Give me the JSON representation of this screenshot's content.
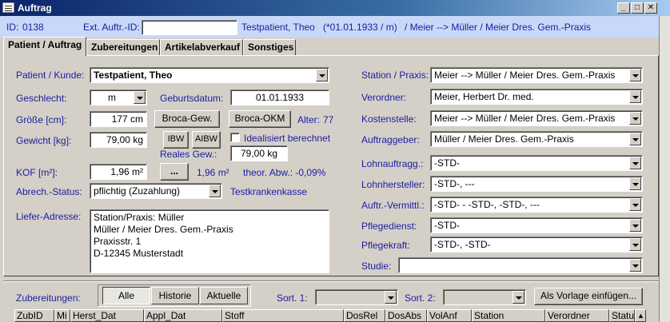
{
  "window": {
    "title": "Auftrag",
    "btn_min": "_",
    "btn_max": "□",
    "btn_close": "✕"
  },
  "header": {
    "id_label": "ID:",
    "id_value": "0138",
    "ext_label": "Ext. Auftr.-ID:",
    "ext_value": "",
    "patient_summary": "Testpatient, Theo",
    "birth_summary": "(*01.01.1933 / m)",
    "praxis_summary": "/ Meier --> Müller / Meier Dres. Gem.-Praxis"
  },
  "tabs": [
    {
      "label": "Patient / Auftrag",
      "active": true
    },
    {
      "label": "Zubereitungen",
      "active": false
    },
    {
      "label": "Artikelabverkauf",
      "active": false
    },
    {
      "label": "Sonstiges",
      "active": false
    }
  ],
  "form": {
    "patient_label": "Patient / Kunde:",
    "patient_value": "Testpatient, Theo",
    "sex_label": "Geschlecht:",
    "sex_value": "m",
    "birth_label": "Geburtsdatum:",
    "birth_value": "01.01.1933",
    "size_label": "Größe [cm]:",
    "size_value": "177 cm",
    "broca_gew": "Broca-Gew.",
    "broca_okm": "Broca-OKM",
    "age_label": "Alter:",
    "age_value": "77",
    "weight_label": "Gewicht [kg]:",
    "weight_value": "79,00 kg",
    "ibw": "IBW",
    "aibw": "AIBW",
    "ideal_label": "Idealisiert berechnet",
    "real_weight_label": "Reales Gew.:",
    "real_weight_value": "79,00 kg",
    "kof_label": "KOF [m²]:",
    "kof_value": "1,96 m²",
    "kof_btn": "...",
    "kof_theor": "1,96 m²",
    "kof_abw": "theor. Abw.: -0,09%",
    "billing_label": "Abrech.-Status:",
    "billing_value": "pflichtig (Zuzahlung)",
    "insurer": "Testkrankenkasse",
    "address_label": "Liefer-Adresse:",
    "address_lines": {
      "l1": "Station/Praxis: Müller",
      "l2": "Müller / Meier Dres. Gem.-Praxis",
      "l3": "Praxisstr. 1",
      "l4": "D-12345 Musterstadt"
    }
  },
  "right_form": {
    "station_label": "Station / Praxis:",
    "station_value": "Meier --> Müller / Meier Dres. Gem.-Praxis",
    "verordner_label": "Verordner:",
    "verordner_value": "Meier, Herbert Dr. med.",
    "kosten_label": "Kostenstelle:",
    "kosten_value": "Meier --> Müller / Meier Dres. Gem.-Praxis",
    "auftrag_label": "Auftraggeber:",
    "auftrag_value": "Müller / Meier Dres. Gem.-Praxis",
    "lohnauftr_label": "Lohnauftragg.:",
    "lohnauftr_value": "-STD-",
    "lohnherst_label": "Lohnhersteller:",
    "lohnherst_value": "-STD-, ---",
    "vermittl_label": "Auftr.-Vermittl.:",
    "vermittl_value": "-STD- - -STD-, -STD-, ---",
    "pflegedienst_label": "Pflegedienst:",
    "pflegedienst_value": "-STD-",
    "pflegekraft_label": "Pflegekraft:",
    "pflegekraft_value": "-STD-, -STD-",
    "studie_label": "Studie:",
    "studie_value": ""
  },
  "bottom": {
    "zubereitungen_label": "Zubereitungen:",
    "seg_all": "Alle",
    "seg_hist": "Historie",
    "seg_current": "Aktuelle",
    "sort1_label": "Sort. 1:",
    "sort2_label": "Sort. 2:",
    "template_btn": "Als Vorlage einfügen...",
    "columns": [
      "ZubID",
      "Mi",
      "Herst_Dat",
      "Appl_Dat",
      "Stoff",
      "DosRel",
      "DosAbs",
      "VolAnf",
      "Station",
      "Verordner",
      "Statu"
    ]
  }
}
